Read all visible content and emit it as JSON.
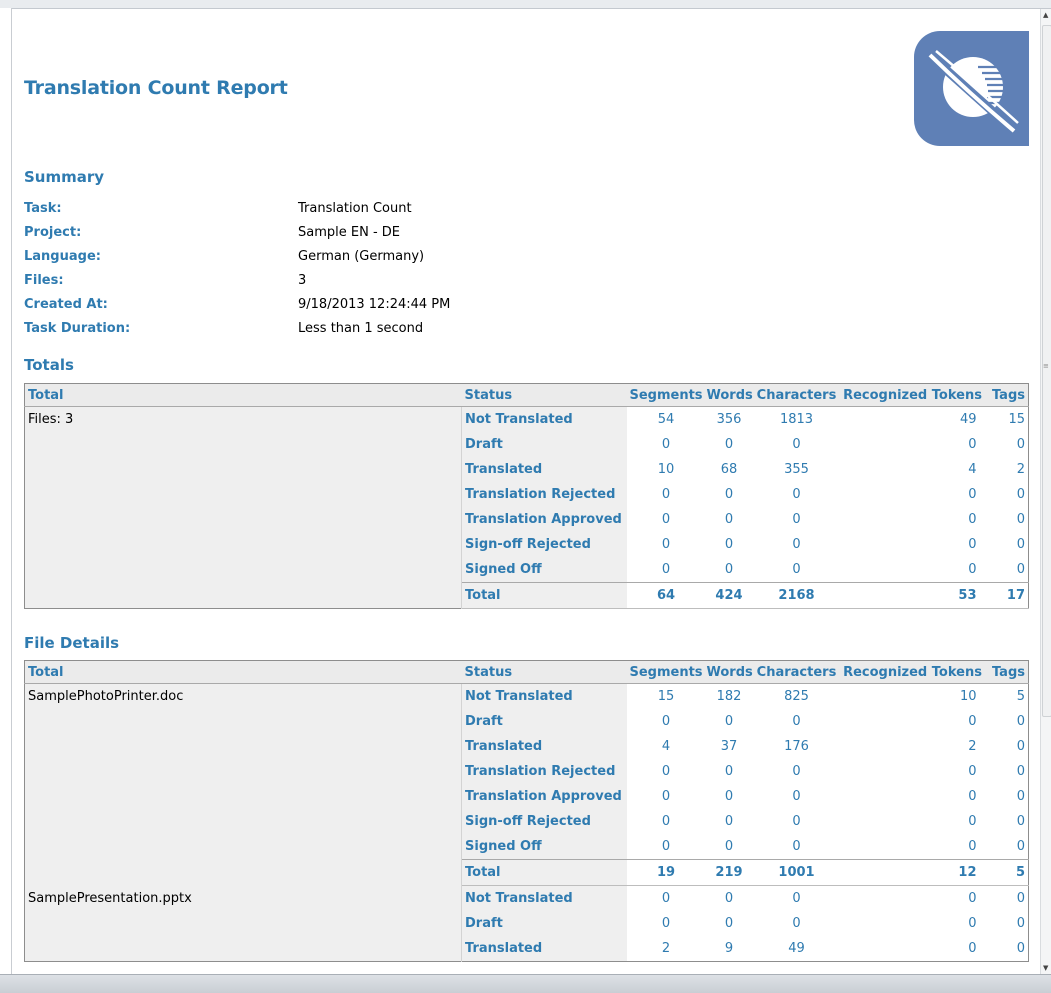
{
  "report": {
    "title": "Translation Count Report"
  },
  "summary": {
    "heading": "Summary",
    "rows": [
      {
        "label": "Task:",
        "value": "Translation Count"
      },
      {
        "label": "Project:",
        "value": "Sample EN - DE"
      },
      {
        "label": "Language:",
        "value": "German (Germany)"
      },
      {
        "label": "Files:",
        "value": "3"
      },
      {
        "label": "Created At:",
        "value": "9/18/2013 12:24:44 PM"
      },
      {
        "label": "Task Duration:",
        "value": "Less than 1 second"
      }
    ]
  },
  "columns": {
    "total": "Total",
    "status": "Status",
    "segments": "Segments",
    "words": "Words",
    "characters": "Characters",
    "tokens": "Recognized Tokens",
    "tags": "Tags"
  },
  "totals": {
    "heading": "Totals",
    "file_label": "Files: 3",
    "rows": [
      {
        "status": "Not Translated",
        "segments": "54",
        "words": "356",
        "characters": "1813",
        "tokens": "49",
        "tags": "15"
      },
      {
        "status": "Draft",
        "segments": "0",
        "words": "0",
        "characters": "0",
        "tokens": "0",
        "tags": "0"
      },
      {
        "status": "Translated",
        "segments": "10",
        "words": "68",
        "characters": "355",
        "tokens": "4",
        "tags": "2"
      },
      {
        "status": "Translation Rejected",
        "segments": "0",
        "words": "0",
        "characters": "0",
        "tokens": "0",
        "tags": "0"
      },
      {
        "status": "Translation Approved",
        "segments": "0",
        "words": "0",
        "characters": "0",
        "tokens": "0",
        "tags": "0"
      },
      {
        "status": "Sign-off Rejected",
        "segments": "0",
        "words": "0",
        "characters": "0",
        "tokens": "0",
        "tags": "0"
      },
      {
        "status": "Signed Off",
        "segments": "0",
        "words": "0",
        "characters": "0",
        "tokens": "0",
        "tags": "0"
      },
      {
        "status": "Total",
        "segments": "64",
        "words": "424",
        "characters": "2168",
        "tokens": "53",
        "tags": "17"
      }
    ]
  },
  "file_details": {
    "heading": "File Details",
    "files": [
      {
        "name": "SamplePhotoPrinter.doc",
        "rows": [
          {
            "status": "Not Translated",
            "segments": "15",
            "words": "182",
            "characters": "825",
            "tokens": "10",
            "tags": "5"
          },
          {
            "status": "Draft",
            "segments": "0",
            "words": "0",
            "characters": "0",
            "tokens": "0",
            "tags": "0"
          },
          {
            "status": "Translated",
            "segments": "4",
            "words": "37",
            "characters": "176",
            "tokens": "2",
            "tags": "0"
          },
          {
            "status": "Translation Rejected",
            "segments": "0",
            "words": "0",
            "characters": "0",
            "tokens": "0",
            "tags": "0"
          },
          {
            "status": "Translation Approved",
            "segments": "0",
            "words": "0",
            "characters": "0",
            "tokens": "0",
            "tags": "0"
          },
          {
            "status": "Sign-off Rejected",
            "segments": "0",
            "words": "0",
            "characters": "0",
            "tokens": "0",
            "tags": "0"
          },
          {
            "status": "Signed Off",
            "segments": "0",
            "words": "0",
            "characters": "0",
            "tokens": "0",
            "tags": "0"
          },
          {
            "status": "Total",
            "segments": "19",
            "words": "219",
            "characters": "1001",
            "tokens": "12",
            "tags": "5"
          }
        ]
      },
      {
        "name": "SamplePresentation.pptx",
        "rows": [
          {
            "status": "Not Translated",
            "segments": "0",
            "words": "0",
            "characters": "0",
            "tokens": "0",
            "tags": "0"
          },
          {
            "status": "Draft",
            "segments": "0",
            "words": "0",
            "characters": "0",
            "tokens": "0",
            "tags": "0"
          },
          {
            "status": "Translated",
            "segments": "2",
            "words": "9",
            "characters": "49",
            "tokens": "0",
            "tags": "0"
          }
        ]
      }
    ]
  },
  "colors": {
    "accent": "#2f7bb0",
    "logo_bg": "#5f80b6",
    "row_bg": "#efefef"
  },
  "icons": {
    "logo": "satellite-planet-logo-icon"
  }
}
